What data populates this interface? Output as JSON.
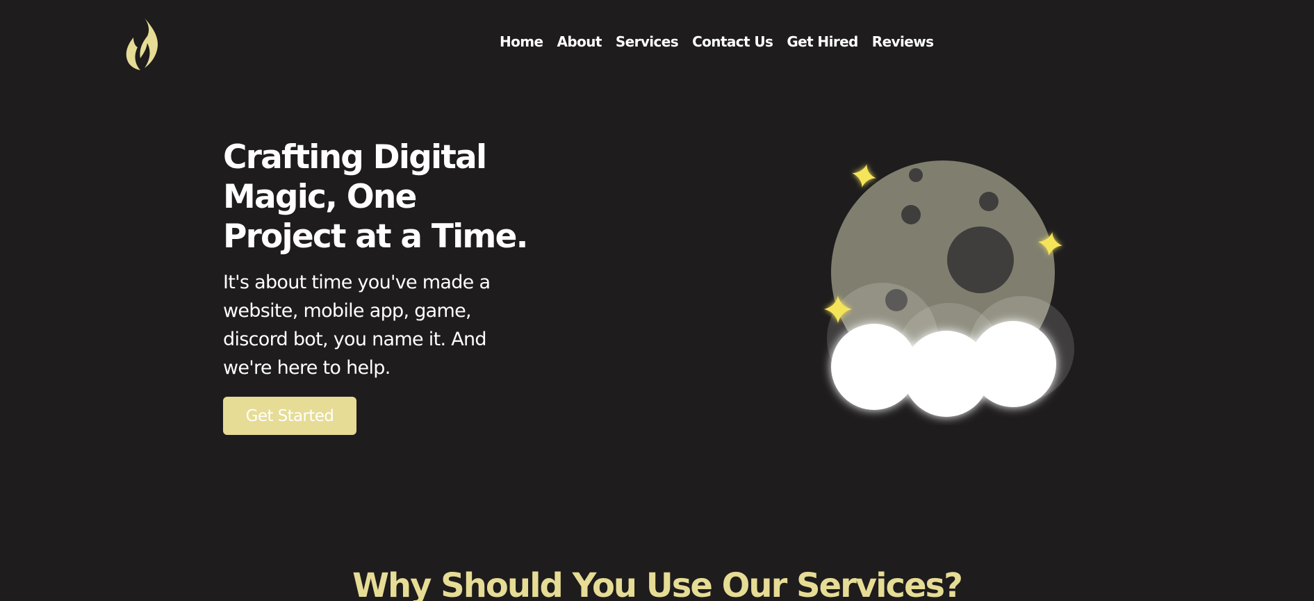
{
  "brand": {
    "logo_icon": "flame-icon",
    "accent_color": "#e6dc95",
    "background_color": "#1e1c1d"
  },
  "nav": {
    "items": [
      {
        "label": "Home"
      },
      {
        "label": "About"
      },
      {
        "label": "Services"
      },
      {
        "label": "Contact Us"
      },
      {
        "label": "Get Hired"
      },
      {
        "label": "Reviews"
      }
    ]
  },
  "hero": {
    "title_lines": [
      "Crafting Digital",
      "Magic, One",
      "Project at a Time."
    ],
    "subtitle": "It's about time you've made a website, mobile app, game, discord bot, you name it. And we're here to help.",
    "cta_label": "Get Started",
    "illustration_icon": "moon-with-clouds-and-stars-icon"
  },
  "section": {
    "heading": "Why Should You Use Our Services?"
  }
}
